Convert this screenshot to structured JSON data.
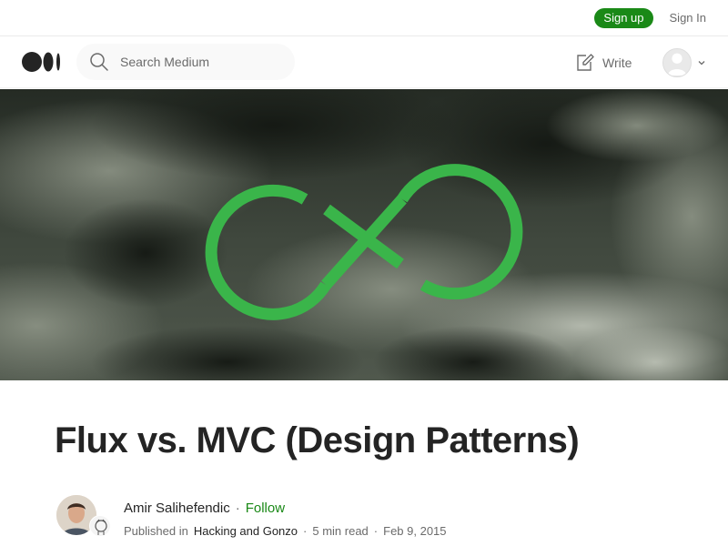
{
  "topbar": {
    "signup_label": "Sign up",
    "signin_label": "Sign In"
  },
  "header": {
    "logo_icon": "medium-logo-icon",
    "search_placeholder": "Search Medium",
    "write_label": "Write"
  },
  "article": {
    "title": "Flux vs. MVC (Design Patterns)",
    "author": "Amir Salihefendic",
    "separator": "·",
    "follow_label": "Follow",
    "published_prefix": "Published in",
    "publication": "Hacking and Gonzo",
    "read_time": "5 min read",
    "date": "Feb 9, 2015"
  },
  "colors": {
    "brand_green": "#1a8917",
    "hero_symbol_green": "#3ab54a",
    "text_primary": "#242424",
    "text_secondary": "#6b6b6b"
  }
}
